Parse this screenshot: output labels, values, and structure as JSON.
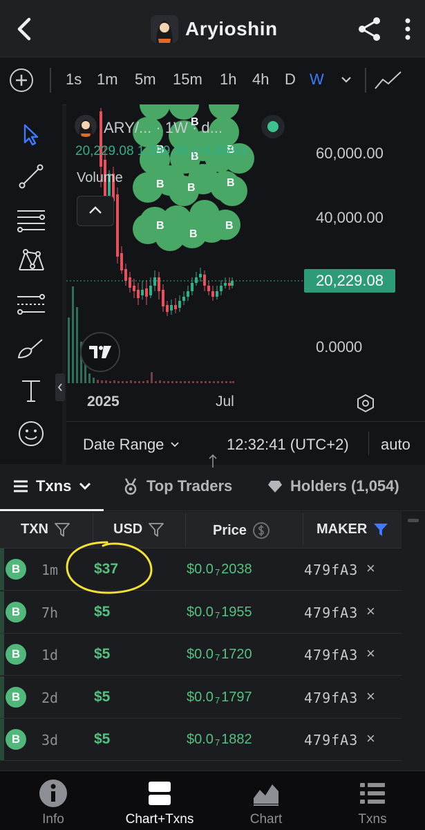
{
  "header": {
    "title": "Aryioshin"
  },
  "timeframes": {
    "items": [
      "1s",
      "1m",
      "5m",
      "15m",
      "1h",
      "4h",
      "D",
      "W"
    ],
    "active": "W"
  },
  "chart_legend": {
    "name": "ARY/... · 1W · d...",
    "values": "20,229.08  1,299.38 (+6.86%)",
    "volume_label": "Volume"
  },
  "chart_data": {
    "type": "candlestick",
    "y_ticks": [
      "60,000.00",
      "40,000.00",
      "0.0000"
    ],
    "x_ticks": [
      "2025",
      "Jul"
    ],
    "last_price": "20,229.08",
    "colors": {
      "up": "#2fb08a",
      "down": "#e8505b",
      "marker": "#4aa866"
    }
  },
  "chart_footer": {
    "date_range": "Date Range",
    "time": "12:32:41 (UTC+2)",
    "mode": "auto"
  },
  "tabs": {
    "txns": "Txns",
    "top_traders": "Top Traders",
    "holders": "Holders (1,054)"
  },
  "table": {
    "headers": {
      "txn": "TXN",
      "usd": "USD",
      "price": "Price",
      "maker": "MAKER"
    },
    "rows": [
      {
        "type": "B",
        "age": "1m",
        "usd": "$37",
        "price_a": "$0.0",
        "price_sub": "7",
        "price_b": "2038",
        "maker": "479fA3"
      },
      {
        "type": "B",
        "age": "7h",
        "usd": "$5",
        "price_a": "$0.0",
        "price_sub": "7",
        "price_b": "1955",
        "maker": "479fA3"
      },
      {
        "type": "B",
        "age": "1d",
        "usd": "$5",
        "price_a": "$0.0",
        "price_sub": "7",
        "price_b": "1720",
        "maker": "479fA3"
      },
      {
        "type": "B",
        "age": "2d",
        "usd": "$5",
        "price_a": "$0.0",
        "price_sub": "7",
        "price_b": "1797",
        "maker": "479fA3"
      },
      {
        "type": "B",
        "age": "3d",
        "usd": "$5",
        "price_a": "$0.0",
        "price_sub": "7",
        "price_b": "1882",
        "maker": "479fA3"
      }
    ],
    "remove_symbol": "×"
  },
  "bottom_nav": {
    "items": [
      "Info",
      "Chart+Txns",
      "Chart",
      "Txns"
    ],
    "active": "Chart+Txns"
  }
}
